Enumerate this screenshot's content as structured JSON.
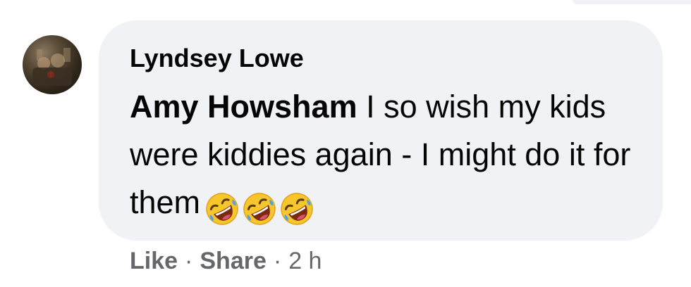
{
  "comment": {
    "author": "Lyndsey Lowe",
    "mention": "Amy Howsham",
    "text": "I so wish my kids were kiddies again - I might do it for them",
    "emojis": [
      "rolling-on-floor-laughing-emoji",
      "rolling-on-floor-laughing-emoji",
      "rolling-on-floor-laughing-emoji"
    ]
  },
  "actions": {
    "like_label": "Like",
    "share_label": "Share",
    "separator": "·",
    "timestamp": "2 h"
  },
  "colors": {
    "bubble_bg": "#f0f2f5",
    "text": "#050505",
    "meta": "#65676b"
  }
}
